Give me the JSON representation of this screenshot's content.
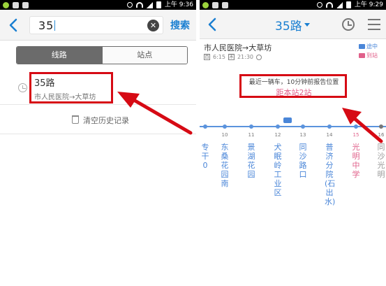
{
  "left": {
    "status": {
      "time": "上午 9:36"
    },
    "search": {
      "value": "35",
      "button": "搜索",
      "clear": "✕"
    },
    "tabs": [
      {
        "label": "线路"
      },
      {
        "label": "站点"
      }
    ],
    "history": [
      {
        "route_number": "35路",
        "route": "市人民医院→大草坊"
      }
    ],
    "clear_history": "清空历史记录"
  },
  "right": {
    "status": {
      "time": "上午 9:29"
    },
    "title": "35路",
    "route_line": "市人民医院→大草坊",
    "first_bus": "首",
    "first_time": "6:15",
    "last_bus": "末",
    "last_time": "21:30",
    "legend": [
      {
        "label": "途中"
      },
      {
        "label": "到站"
      }
    ],
    "hint_line1": "最近一辆车，10分钟前报告位置",
    "hint_line2": "距本站2站",
    "stops": [
      {
        "num": "",
        "name": "专干0"
      },
      {
        "num": "10",
        "name": "东桑花园南"
      },
      {
        "num": "11",
        "name": "景湖花园"
      },
      {
        "num": "12",
        "name": "犬眠岭工业区"
      },
      {
        "num": "13",
        "name": "同沙路口"
      },
      {
        "num": "14",
        "name": "普济分院(石出水)"
      },
      {
        "num": "15",
        "name": "光明中学"
      },
      {
        "num": "16",
        "name": "同沙光明"
      }
    ]
  }
}
